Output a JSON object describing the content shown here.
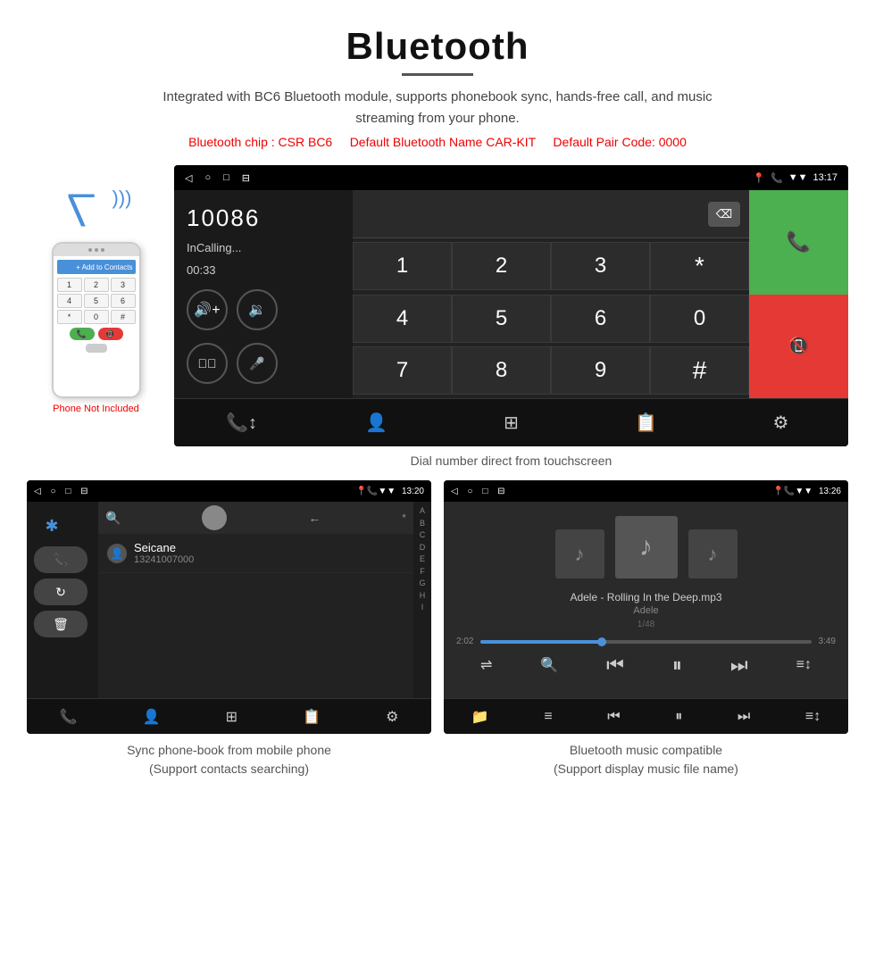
{
  "header": {
    "title": "Bluetooth",
    "description": "Integrated with BC6 Bluetooth module, supports phonebook sync, hands-free call, and music streaming from your phone.",
    "spec_chip": "Bluetooth chip : CSR BC6",
    "spec_name": "Default Bluetooth Name CAR-KIT",
    "spec_code": "Default Pair Code: 0000"
  },
  "phone_mockup": {
    "not_included": "Phone Not Included"
  },
  "car_screen": {
    "status_bar": {
      "nav_icons": [
        "◁",
        "○",
        "□",
        "⊟"
      ],
      "right_icons": [
        "📍",
        "📞",
        "▼",
        "13:17"
      ]
    },
    "call_number": "10086",
    "call_status": "InCalling...",
    "call_timer": "00:33",
    "keypad": [
      "1",
      "2",
      "3",
      "*",
      "4",
      "5",
      "6",
      "0",
      "7",
      "8",
      "9",
      "#"
    ],
    "caption": "Dial number direct from touchscreen"
  },
  "phonebook_screen": {
    "status_bar_right": "13:20",
    "contact_name": "Seicane",
    "contact_number": "13241007000",
    "alphabet": [
      "A",
      "B",
      "C",
      "D",
      "E",
      "F",
      "G",
      "H",
      "I"
    ],
    "caption_line1": "Sync phone-book from mobile phone",
    "caption_line2": "(Support contacts searching)"
  },
  "music_screen": {
    "status_bar_right": "13:26",
    "song_title": "Adele - Rolling In the Deep.mp3",
    "artist": "Adele",
    "track_info": "1/48",
    "time_current": "2:02",
    "time_total": "3:49",
    "caption_line1": "Bluetooth music compatible",
    "caption_line2": "(Support display music file name)"
  },
  "icons": {
    "bluetooth": "✱",
    "phone": "📞",
    "volume_up": "🔊",
    "volume_down": "🔉",
    "transfer": "↗",
    "mic": "🎤",
    "end_call": "📵",
    "search": "🔍",
    "contacts": "👤",
    "grid": "⊞",
    "settings": "⚙",
    "phone_call": "📞",
    "shuffle": "⇌",
    "prev": "⏮",
    "play_pause": "⏸",
    "next": "⏭",
    "equalizer": "≡"
  }
}
